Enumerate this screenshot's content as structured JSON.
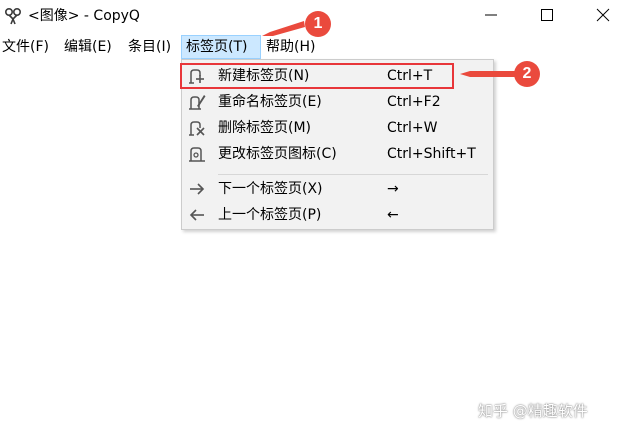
{
  "window": {
    "title": "<图像> - CopyQ"
  },
  "menubar": {
    "items": [
      {
        "label": "文件(F)"
      },
      {
        "label": "编辑(E)"
      },
      {
        "label": "条目(I)"
      },
      {
        "label": "标签页(T)"
      },
      {
        "label": "帮助(H)"
      }
    ]
  },
  "dropdown": {
    "items": [
      {
        "label": "新建标签页(N)",
        "shortcut": "Ctrl+T",
        "icon": "new-tab-icon"
      },
      {
        "label": "重命名标签页(E)",
        "shortcut": "Ctrl+F2",
        "icon": "rename-tab-icon"
      },
      {
        "label": "删除标签页(M)",
        "shortcut": "Ctrl+W",
        "icon": "delete-tab-icon"
      },
      {
        "label": "更改标签页图标(C)",
        "shortcut": "Ctrl+Shift+T",
        "icon": "change-tab-icon-icon"
      },
      {
        "label": "下一个标签页(X)",
        "shortcut": "→",
        "icon": "arrow-right-icon"
      },
      {
        "label": "上一个标签页(P)",
        "shortcut": "←",
        "icon": "arrow-left-icon"
      }
    ]
  },
  "annotations": {
    "badge_1": "1",
    "badge_2": "2",
    "color": "#ea4a3d"
  },
  "watermark": "知乎 @精趣软件"
}
